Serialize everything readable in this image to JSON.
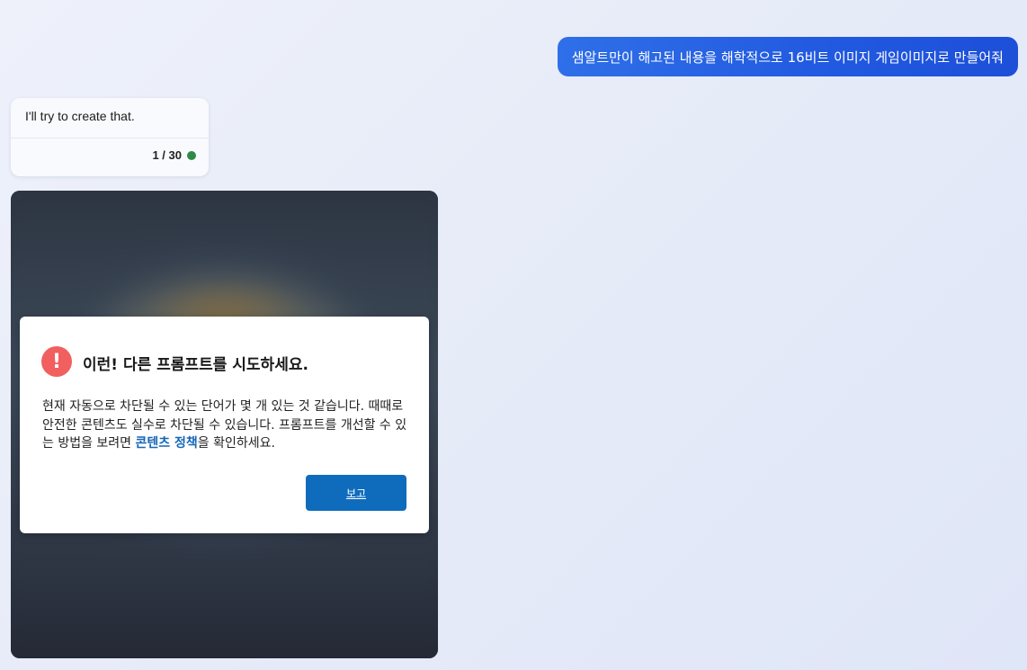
{
  "chat": {
    "user_message": "샘알트만이 해고된 내용을 해학적으로 16비트 이미지 게임이미지로 만들어줘",
    "bot_message": "I'll try to create that.",
    "bot_counter": "1 / 30"
  },
  "warning": {
    "icon_glyph": "!",
    "title": "이런! 다른 프롬프트를 시도하세요.",
    "body_before": "현재 자동으로 차단될 수 있는 단어가 몇 개 있는 것 같습니다. 때때로 안전한 콘텐츠도 실수로 차단될 수 있습니다. 프롬프트를 개선할 수 있는 방법을 보려면 ",
    "policy_link": "콘텐츠 정책",
    "body_after": "을 확인하세요.",
    "report_button": "보고"
  },
  "colors": {
    "user_bubble": "#2159e0",
    "status_dot": "#2e8b45",
    "warning_icon": "#f15f5f",
    "primary_button": "#0f6cbd",
    "link": "#1565b8"
  },
  "icons": {
    "warning": "exclamation-circle-icon",
    "status": "green-dot-icon"
  }
}
